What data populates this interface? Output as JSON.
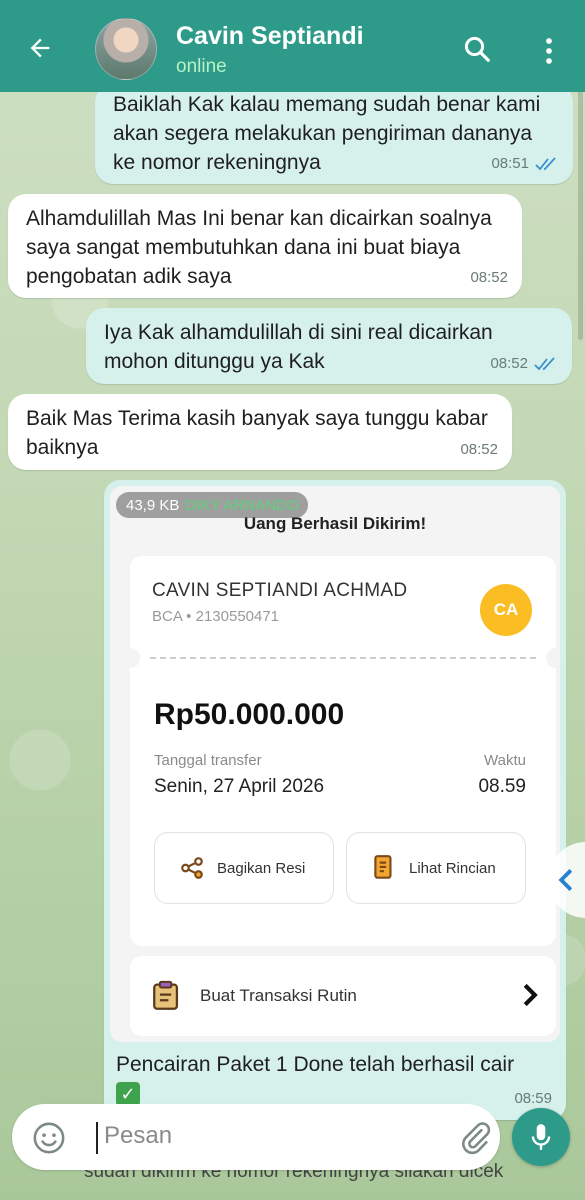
{
  "header": {
    "contact_name": "Cavin Septiandi",
    "status": "online",
    "back_icon": "arrow-left-icon",
    "search_icon": "search-icon",
    "menu_icon": "more-vertical-icon"
  },
  "messages": [
    {
      "direction": "out",
      "text": "Baiklah Kak kalau memang sudah benar kami akan segera melakukan pengiriman dananya ke nomor rekeningnya",
      "time": "08:51",
      "read": true
    },
    {
      "direction": "in",
      "text": "Alhamdulillah Mas Ini benar kan dicairkan soalnya saya sangat membutuhkan dana ini buat biaya pengobatan adik saya",
      "time": "08:52"
    },
    {
      "direction": "out",
      "text": "Iya Kak alhamdulillah di sini real dicairkan mohon ditunggu ya Kak",
      "time": "08:52",
      "read": true
    },
    {
      "direction": "in",
      "text": "Baik Mas Terima kasih banyak saya tunggu kabar baiknya",
      "time": "08:52"
    }
  ],
  "image_message": {
    "file_size": "43,9 KB",
    "sender_tag": "DIKY ARNANDO",
    "receipt": {
      "title": "Uang Berhasil Dikirim!",
      "account_name": "CAVIN SEPTIANDI ACHMAD",
      "account_number": "BCA • 2130550471",
      "avatar_initials": "CA",
      "amount": "Rp50.000.000",
      "date_label": "Tanggal transfer",
      "date_value": "Senin, 27 April 2026",
      "time_label": "Waktu",
      "time_value": "08.59",
      "share_label": "Bagikan Resi",
      "details_label": "Lihat Rincian",
      "routine_label": "Buat Transaksi Rutin"
    },
    "caption": "Pencairan Paket 1 Done telah berhasil cair",
    "caption_emoji": "✓",
    "time": "08:59"
  },
  "underlying_text": "sudah dikirim ke nomor rekeningnya silakan dicek",
  "input": {
    "placeholder": "Pesan"
  },
  "colors": {
    "header": "#2e9b8a",
    "outgoing_bubble": "#d6f0ec",
    "incoming_bubble": "#ffffff",
    "accent": "#2e9b8a",
    "receipt_avatar": "#fbbd24"
  }
}
